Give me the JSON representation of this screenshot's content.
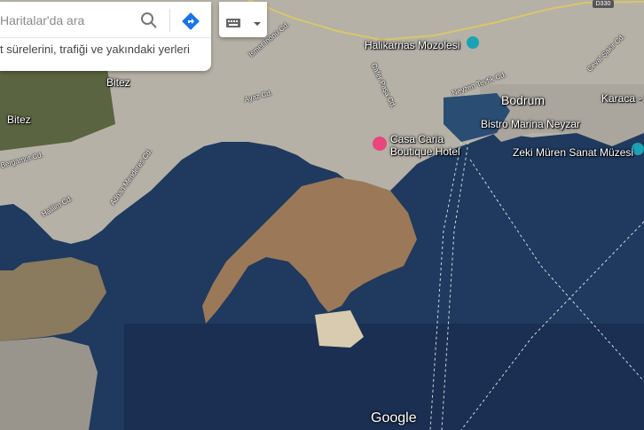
{
  "search": {
    "placeholder": "Haritalar'da ara",
    "suggestion_text": "t sürelerini, trafiği ve yakındaki yerleri"
  },
  "icons": {
    "search": "search-icon",
    "directions": "directions-icon",
    "keyboard": "keyboard-icon",
    "caret": "caret-down-icon"
  },
  "road_badge": "D330",
  "places": {
    "halikarnas": "Halikarnas Mozolesi",
    "bodrum": "Bodrum",
    "karaca": "Karaca - Ka",
    "bistro": "Bistro Marina Neyzar",
    "zeki": "Zeki Müren Sanat Müzesi",
    "casa_line1": "Casa Caria",
    "casa_line2": "Boutique Hotel",
    "bitez1": "Bitez",
    "bitez2": "Bitez"
  },
  "streets": {
    "ismet": "İsmet İnönü Cd.",
    "cevat": "Cevat Şakir Cd.",
    "ayaz": "Ayaz Cd.",
    "cafer": "Cafer Paşa Cd.",
    "neyzen": "Neyzen Tevfik Cd.",
    "bergamut": "Bergamut Cd.",
    "adnan": "Adnan Menderes Cd.",
    "halilim": "Halilim Cd."
  },
  "footer": {
    "google": "Google"
  },
  "colors": {
    "sea_deep": "#1b3358",
    "sea_mid": "#244a70",
    "land_urban": "#b9b5ac",
    "land_brown": "#9c7a5c",
    "land_green": "#4e5a3a",
    "poi_pink": "#e8467c",
    "poi_teal": "#1aa3b5"
  }
}
